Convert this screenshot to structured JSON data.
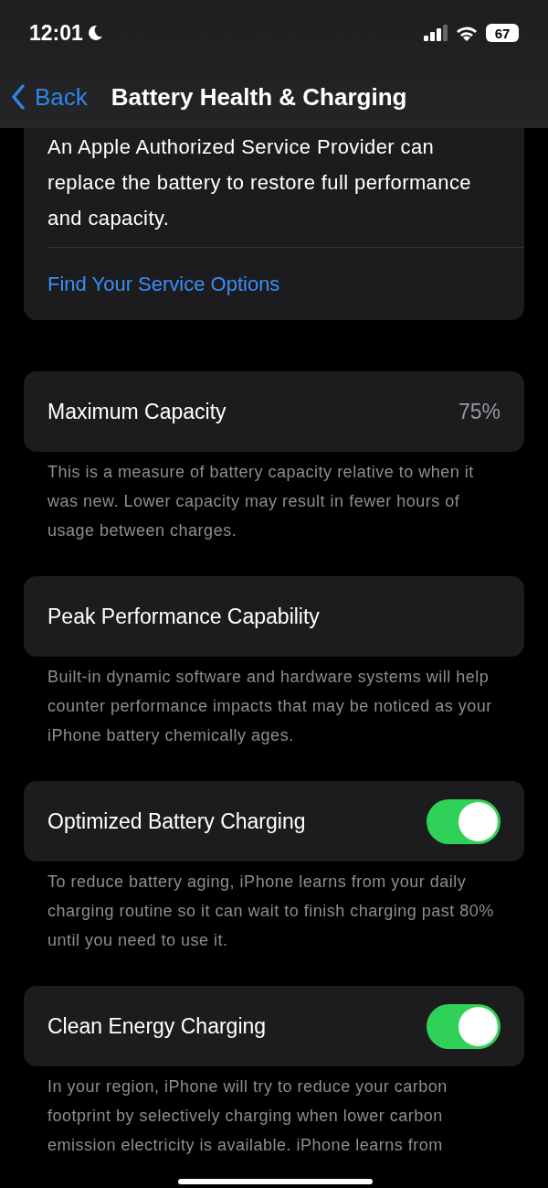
{
  "status_bar": {
    "time": "12:01",
    "battery": "67"
  },
  "nav": {
    "back": "Back",
    "title": "Battery Health & Charging"
  },
  "service_card": {
    "text": "An Apple Authorized Service Provider can replace the battery to restore full performance and capacity.",
    "link": "Find Your Service Options"
  },
  "sections": [
    {
      "kind": "value",
      "label": "Maximum Capacity",
      "value": "75%",
      "footer": "This is a measure of battery capacity relative to when it was new. Lower capacity may result in fewer hours of usage between charges."
    },
    {
      "kind": "plain",
      "label": "Peak Performance Capability",
      "footer": "Built-in dynamic software and hardware systems will help counter performance impacts that may be noticed as your iPhone battery chemically ages."
    },
    {
      "kind": "toggle",
      "label": "Optimized Battery Charging",
      "on": true,
      "footer": "To reduce battery aging, iPhone learns from your daily charging routine so it can wait to finish charging past 80% until you need to use it."
    },
    {
      "kind": "toggle",
      "label": "Clean Energy Charging",
      "on": true,
      "footer": "In your region, iPhone will try to reduce your carbon footprint by selectively charging when lower carbon emission electricity is available. iPhone learns from"
    }
  ]
}
